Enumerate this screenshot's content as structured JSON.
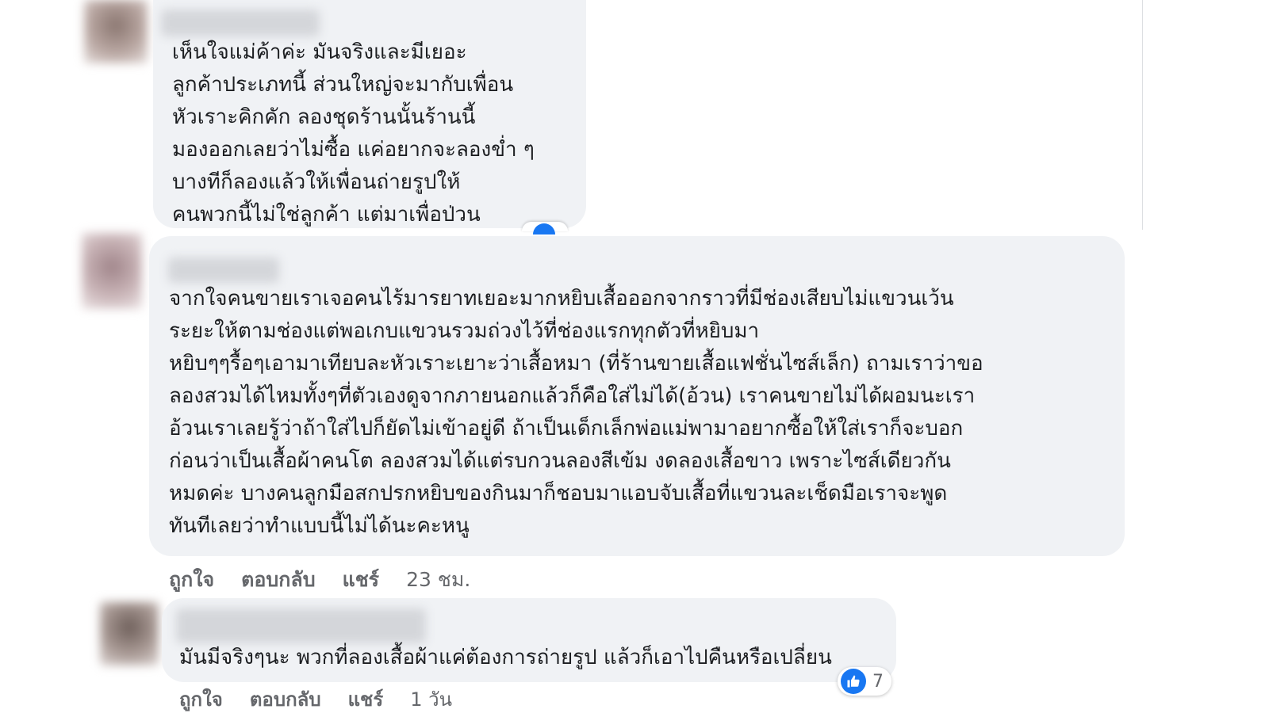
{
  "comments": [
    {
      "text_lines": [
        "เห็นใจแม่ค้าค่ะ มันจริงและมีเยอะ",
        "ลูกค้าประเภทนี้ ส่วนใหญ่จะมากับเพื่อน",
        "หัวเราะคิกคัก ลองชุดร้านนั้นร้านนี้",
        "มองออกเลยว่าไม่ซื้อ แค่อยากจะลองข่ำ ๆ",
        "บางทีก็ลองแล้วให้เพื่อนถ่ายรูปให้",
        "คนพวกนี้ไม่ใช่ลูกค้า แต่มาเพื่อป่วน"
      ]
    },
    {
      "text_lines": [
        "จากใจคนขายเราเจอคนไร้มารยาทเยอะมากหยิบเสื้อออกจากราวที่มีช่องเสียบไม่แขวนเว้น",
        "ระยะให้ตามช่องแต่พอเกบแขวนรวมถ่วงไว้ที่ช่องแรกทุกตัวที่หยิบมา",
        "หยิบๆๆรื้อๆเอามาเทียบละหัวเราะเยาะว่าเสื้อหมา (ที่ร้านขายเสื้อแฟชั่นไซส์เล็ก) ถามเราว่าขอ",
        "ลองสวมได้ไหมทั้งๆที่ตัวเองดูจากภายนอกแล้วก็คือใส่ไม่ได้(อ้วน) เราคนขายไม่ได้ผอมนะเรา",
        "อ้วนเราเลยรู้ว่าถ้าใส่ไปก็ยัดไม่เข้าอยู่ดี ถ้าเป็นเด็กเล็กพ่อแม่พามาอยากซื้อให้ใส่เราก็จะบอก",
        "ก่อนว่าเป็นเสื้อผ้าคนโต ลองสวมได้แต่รบกวนลองสีเข้ม งดลองเสื้อขาว เพราะไซส์เดียวกัน",
        "หมดค่ะ บางคนลูกมือสกปรกหยิบของกินมาก็ชอบมาแอบจับเสื้อที่แขวนละเช็ดมือเราจะพูด",
        "ทันทีเลยว่าทำแบบนี้ไม่ได้นะคะหนู"
      ],
      "actions": {
        "like": "ถูกใจ",
        "reply": "ตอบกลับ",
        "share": "แชร์",
        "time": "23 ชม."
      }
    },
    {
      "text_lines": [
        "มันมีจริงๆนะ พวกที่ลองเสื้อผ้าแค่ต้องการถ่ายรูป แล้วก็เอาไปคืนหรือเปลี่ยน"
      ],
      "reaction": {
        "icon": "thumbs-up-icon",
        "count": "7",
        "color": "#1877f2"
      },
      "actions": {
        "like": "ถูกใจ",
        "reply": "ตอบกลับ",
        "share": "แชร์",
        "time": "1 วัน"
      }
    }
  ],
  "colors": {
    "bubble": "#f0f2f5",
    "text": "#1c1e21",
    "muted": "#65676b",
    "accent": "#1877f2"
  }
}
